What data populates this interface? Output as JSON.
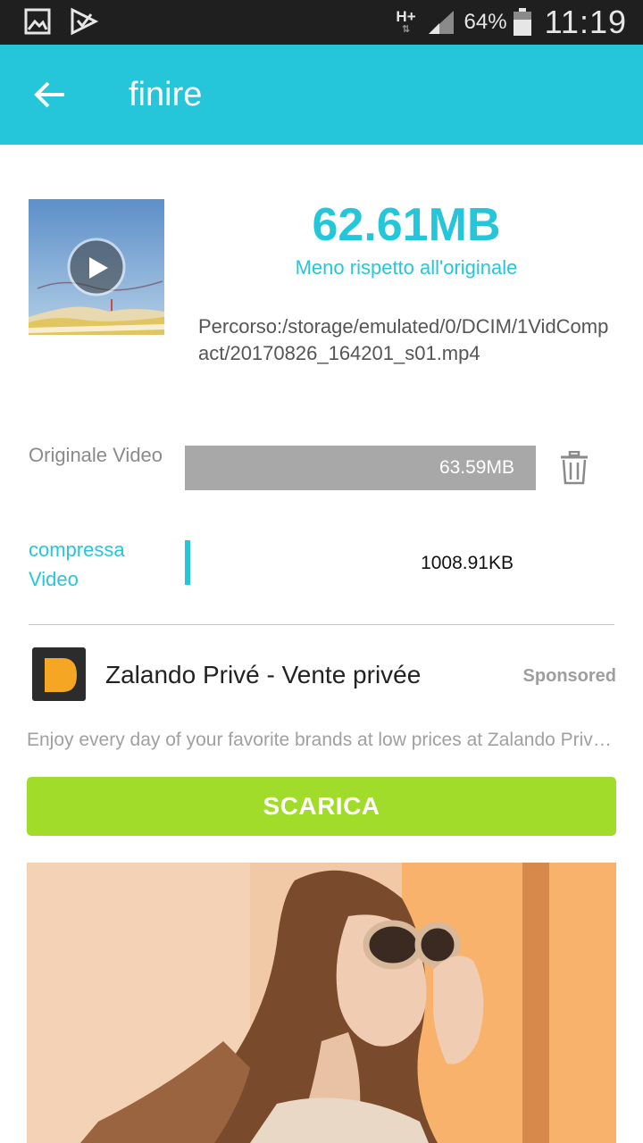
{
  "status_bar": {
    "network": "H+",
    "battery_percent": "64%",
    "time": "11:19",
    "icons": [
      "gallery-notification-icon",
      "check-notification-icon",
      "signal-icon",
      "battery-icon"
    ]
  },
  "app_bar": {
    "title": "finire",
    "back_icon": "arrow-back-icon",
    "color": "#26c6da"
  },
  "summary": {
    "saved_size": "62.61MB",
    "saved_caption": "Meno rispetto all'originale",
    "path": "Percorso:/storage/emulated/0/DCIM/1VidCompact/20170826_164201_s01.mp4",
    "thumbnail_icon": "play-icon"
  },
  "original": {
    "label": "Originale Video",
    "size": "63.59MB",
    "delete_icon": "trash-icon"
  },
  "compressed": {
    "label": "compressa Video",
    "size": "1008.91KB",
    "ratio_to_original": 0.0155
  },
  "ad": {
    "title": "Zalando Privé - Vente privée",
    "sponsored": "Sponsored",
    "description": "Enjoy every day of your favorite brands at low prices at Zalando Privé - Vente privée",
    "cta": "SCARICA",
    "cta_color": "#a2dc2a",
    "icon": "zalando-play-logo-icon"
  }
}
